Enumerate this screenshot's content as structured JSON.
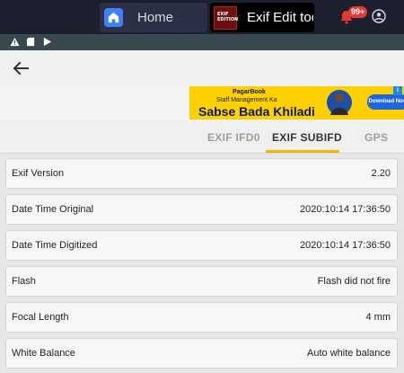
{
  "host": {
    "home_tab_label": "Home",
    "app_tab_label": "Exif Edit toc",
    "app_thumb_text": "EXIF EDITION",
    "notification_badge": "99+"
  },
  "ad": {
    "brand": "PagarBook",
    "subtitle": "Staff Management Ka",
    "headline": "Sabse Bada Khiladi",
    "cta": "Download Now",
    "info": "i"
  },
  "tabs": [
    {
      "label": "EXIF IFD0",
      "active": false
    },
    {
      "label": "EXIF SUBIFD",
      "active": true
    },
    {
      "label": "GPS",
      "active": false
    }
  ],
  "rows": [
    {
      "key": "Exif Version",
      "value": "2.20"
    },
    {
      "key": "Date Time Original",
      "value": "2020:10:14 17:36:50"
    },
    {
      "key": "Date Time Digitized",
      "value": "2020:10:14 17:36:50"
    },
    {
      "key": "Flash",
      "value": "Flash did not fire"
    },
    {
      "key": "Focal Length",
      "value": "4 mm"
    },
    {
      "key": "White Balance",
      "value": "Auto white balance"
    }
  ],
  "colors": {
    "accent": "#f4b400",
    "status_bar": "#39474f",
    "host_bar": "#1b1f2e",
    "ad_bg": "#ffd000"
  }
}
